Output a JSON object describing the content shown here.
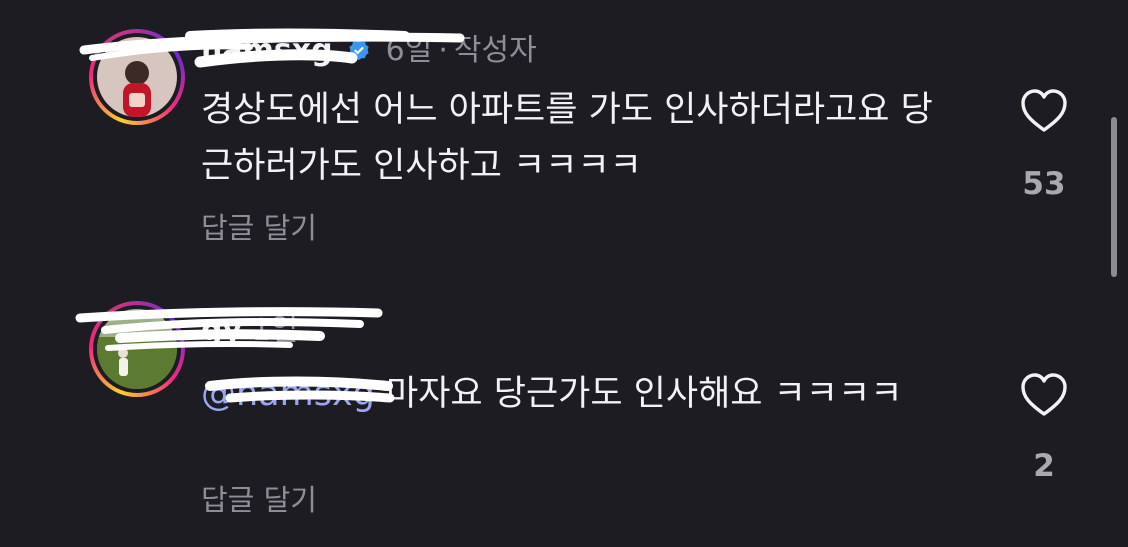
{
  "comments": [
    {
      "username": "hamsxg",
      "time": "6일",
      "author_badge": "작성자",
      "text": "경상도에선 어느 아파트를 가도 인사하더라고요 당근하러가도 인사하고 ㅋㅋㅋㅋ",
      "reply_label": "답글 달기",
      "like_count": "53",
      "avatar_icon": "profile-photo"
    },
    {
      "username": "gy",
      "time": "1일",
      "mention": "@hamsxg",
      "text": " 마자요 당근가도 인사해요 ㅋㅋㅋㅋ",
      "reply_label": "답글 달기",
      "like_count": "2",
      "avatar_icon": "profile-photo"
    }
  ],
  "icons": {
    "like": "heart-outline-icon",
    "verified": "verified-badge-icon"
  },
  "colors": {
    "background": "#1c1c22",
    "mention": "#9aa7f0",
    "verified": "#3897f0"
  }
}
